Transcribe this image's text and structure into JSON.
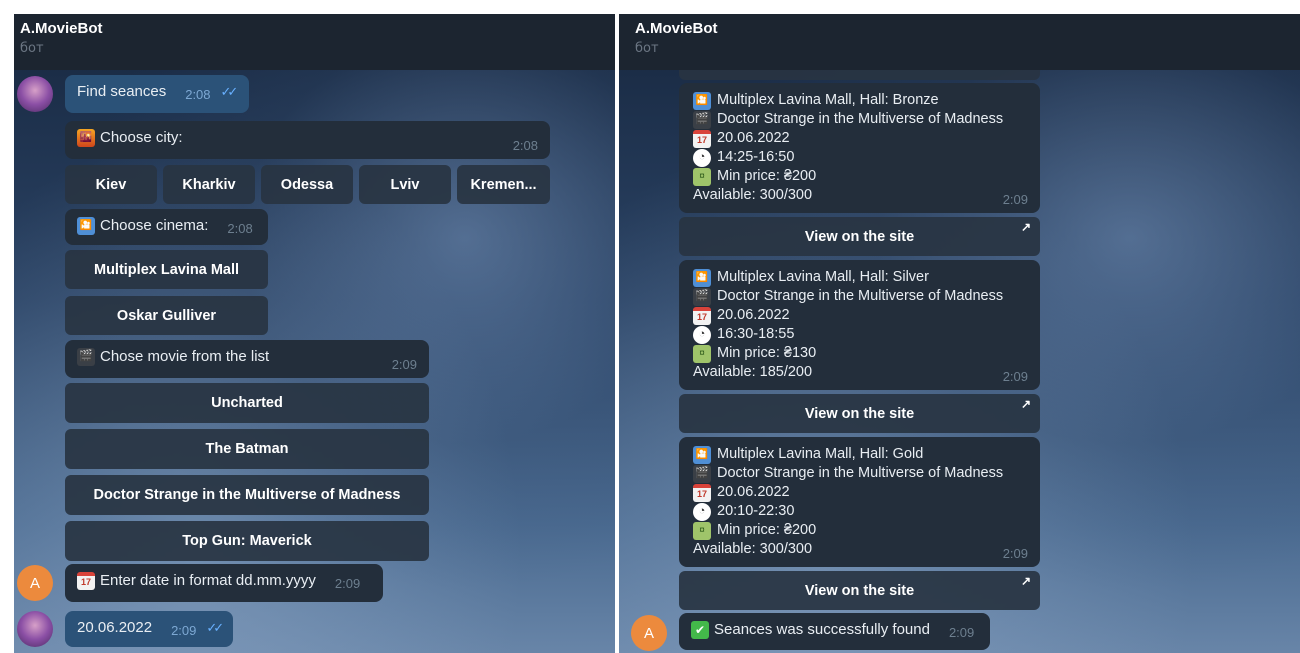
{
  "left_chat": {
    "header": {
      "title": "A.MovieBot",
      "subtitle": "бот"
    },
    "user_avatar_letter": "",
    "bot_avatar_letter": "A",
    "msg_find": {
      "text": "Find seances",
      "time": "2:08",
      "status": "✓✓"
    },
    "msg_city": {
      "text": "Choose city:",
      "time": "2:08"
    },
    "city_buttons": [
      "Kiev",
      "Kharkiv",
      "Odessa",
      "Lviv",
      "Kremen..."
    ],
    "msg_cinema": {
      "text": "Choose cinema:",
      "time": "2:08"
    },
    "cinema_buttons": [
      "Multiplex Lavina Mall",
      "Oskar Gulliver"
    ],
    "msg_movie": {
      "text": "Chose movie from the list",
      "time": "2:09"
    },
    "movie_buttons": [
      "Uncharted",
      "The Batman",
      "Doctor Strange in the Multiverse of Madness",
      "Top Gun: Maverick"
    ],
    "msg_date_prompt": {
      "text": "Enter date in format dd.mm.yyyy",
      "time": "2:09"
    },
    "msg_date": {
      "text": "20.06.2022",
      "time": "2:09",
      "status": "✓✓"
    }
  },
  "right_chat": {
    "header": {
      "title": "A.MovieBot",
      "subtitle": "бот"
    },
    "bot_avatar_letter": "A",
    "seances": [
      {
        "cinema": "Multiplex Lavina Mall, Hall: Bronze",
        "movie": "Doctor Strange in the Multiverse of Madness",
        "date": "20.06.2022",
        "time_range": "14:25-16:50",
        "price": "Min price: ₴200",
        "available": "Available: 300/300",
        "msg_time": "2:09"
      },
      {
        "cinema": "Multiplex Lavina Mall, Hall: Silver",
        "movie": "Doctor Strange in the Multiverse of Madness",
        "date": "20.06.2022",
        "time_range": "16:30-18:55",
        "price": "Min price: ₴130",
        "available": "Available: 185/200",
        "msg_time": "2:09"
      },
      {
        "cinema": "Multiplex Lavina Mall, Hall: Gold",
        "movie": "Doctor Strange in the Multiverse of Madness",
        "date": "20.06.2022",
        "time_range": "20:10-22:30",
        "price": "Min price: ₴200",
        "available": "Available: 300/300",
        "msg_time": "2:09"
      }
    ],
    "site_button_label": "View on the site",
    "site_button_icon": "↗",
    "msg_found": {
      "text": "Seances was successfully found",
      "time": "2:09"
    }
  },
  "icons": {
    "city": "🌇",
    "cinema": "🎦",
    "clapper": "🎬",
    "calendar": "📅",
    "clock": "🕐",
    "money": "💴",
    "check": "✅"
  }
}
